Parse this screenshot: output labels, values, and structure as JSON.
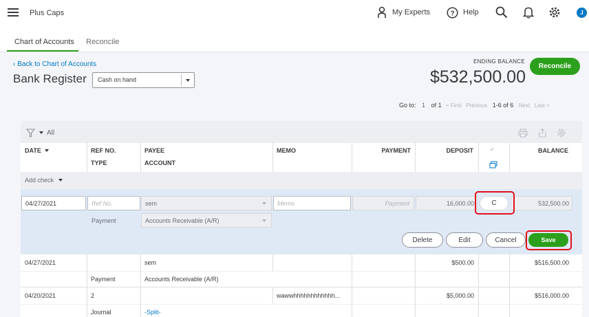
{
  "app": {
    "company_name": "Plus Caps",
    "avatar_letter": "J"
  },
  "topbar": {
    "my_experts_label": "My Experts",
    "help_label": "Help"
  },
  "tabs": [
    {
      "label": "Chart of Accounts",
      "active": true
    },
    {
      "label": "Reconcile",
      "active": false
    }
  ],
  "header": {
    "back_link": "Back to Chart of Accounts",
    "page_title": "Bank Register",
    "account_select_value": "Cash on hand",
    "ending_balance_label": "ENDING BALANCE",
    "ending_balance_value": "$532,500.00",
    "reconcile_button": "Reconcile"
  },
  "pagination": {
    "goto_label": "Go to:",
    "page_value": "1",
    "of_label": "of 1",
    "first": "< First",
    "previous": "Previous",
    "range": "1-6 of 6",
    "next": "Next",
    "last": "Last >"
  },
  "filter": {
    "label": "All"
  },
  "columns": {
    "date": "DATE",
    "ref_no": "REF NO.",
    "type": "TYPE",
    "payee": "PAYEE",
    "account": "ACCOUNT",
    "memo": "MEMO",
    "payment": "PAYMENT",
    "deposit": "DEPOSIT",
    "balance": "BALANCE"
  },
  "add_check_label": "Add check",
  "edit_row": {
    "date": "04/27/2021",
    "ref_placeholder": "Ref No.",
    "payee": "sem",
    "memo_placeholder": "Memo",
    "payment_placeholder": "Payment",
    "deposit": "16,000.00",
    "cleared": "C",
    "balance": "532,500.00",
    "type": "Payment",
    "account": "Accounts Receivable (A/R)",
    "buttons": {
      "delete": "Delete",
      "edit": "Edit",
      "cancel": "Cancel",
      "save": "Save"
    }
  },
  "rows": [
    {
      "date": "04/27/2021",
      "ref": "",
      "payee": "sem",
      "memo": "",
      "payment": "",
      "deposit": "$500.00",
      "balance": "$516,500.00",
      "type": "Payment",
      "account": "Accounts Receivable (A/R)"
    },
    {
      "date": "04/20/2021",
      "ref": "2",
      "payee": "",
      "memo": "wawwhhhhhhhhhhhh...",
      "payment": "",
      "deposit": "$5,000.00",
      "balance": "$516,000.00",
      "type": "Journal",
      "account": "-Split-"
    }
  ],
  "colors": {
    "accent_green": "#2ca01c",
    "link_blue": "#0077c5",
    "highlight_red": "#e0101b",
    "edit_row_bg": "#dfe9f5"
  }
}
